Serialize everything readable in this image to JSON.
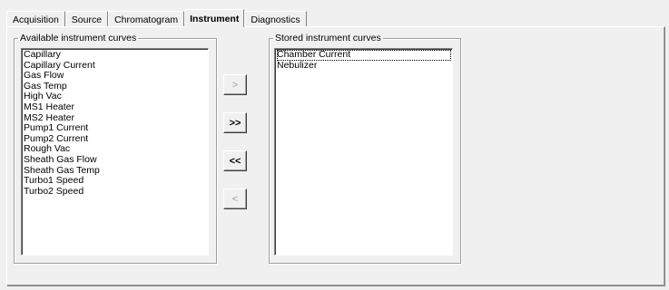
{
  "tabs": [
    {
      "label": "Acquisition",
      "active": false
    },
    {
      "label": "Source",
      "active": false
    },
    {
      "label": "Chromatogram",
      "active": false
    },
    {
      "label": "Instrument",
      "active": true
    },
    {
      "label": "Diagnostics",
      "active": false
    }
  ],
  "available": {
    "legend": "Available instrument curves",
    "items": [
      "Capillary",
      "Capillary Current",
      "Gas Flow",
      "Gas Temp",
      "High Vac",
      "MS1 Heater",
      "MS2 Heater",
      "Pump1 Current",
      "Pump2 Current",
      "Rough Vac",
      "Sheath Gas Flow",
      "Sheath Gas Temp",
      "Turbo1 Speed",
      "Turbo2 Speed"
    ]
  },
  "stored": {
    "legend": "Stored instrument curves",
    "items": [
      "Chamber Current",
      "Nebulizer"
    ],
    "focused_index": 0
  },
  "buttons": {
    "add": ">",
    "add_all": ">>",
    "remove_all": "<<",
    "remove": "<"
  }
}
